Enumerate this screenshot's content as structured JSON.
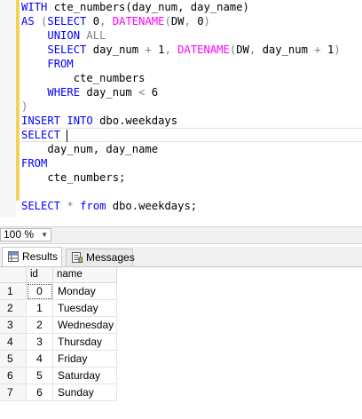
{
  "editor": {
    "lines": [
      [
        {
          "t": "WITH ",
          "c": "kw"
        },
        {
          "t": "cte_numbers(day_num, day_name)",
          "c": ""
        }
      ],
      [
        {
          "t": "AS ",
          "c": "kw"
        },
        {
          "t": "(",
          "c": "gr"
        },
        {
          "t": "SELECT ",
          "c": "kw"
        },
        {
          "t": "0",
          "c": ""
        },
        {
          "t": ", ",
          "c": "gr"
        },
        {
          "t": "DATENAME",
          "c": "fn"
        },
        {
          "t": "(",
          "c": "gr"
        },
        {
          "t": "DW",
          "c": ""
        },
        {
          "t": ", ",
          "c": "gr"
        },
        {
          "t": "0",
          "c": ""
        },
        {
          "t": ")",
          "c": "gr"
        }
      ],
      [
        {
          "t": "    ",
          "c": ""
        },
        {
          "t": "UNION ",
          "c": "kw"
        },
        {
          "t": "ALL",
          "c": "gr"
        }
      ],
      [
        {
          "t": "    ",
          "c": ""
        },
        {
          "t": "SELECT ",
          "c": "kw"
        },
        {
          "t": "day_num ",
          "c": ""
        },
        {
          "t": "+ ",
          "c": "gr"
        },
        {
          "t": "1",
          "c": ""
        },
        {
          "t": ", ",
          "c": "gr"
        },
        {
          "t": "DATENAME",
          "c": "fn"
        },
        {
          "t": "(",
          "c": "gr"
        },
        {
          "t": "DW",
          "c": ""
        },
        {
          "t": ", ",
          "c": "gr"
        },
        {
          "t": "day_num ",
          "c": ""
        },
        {
          "t": "+ ",
          "c": "gr"
        },
        {
          "t": "1",
          "c": ""
        },
        {
          "t": ")",
          "c": "gr"
        }
      ],
      [
        {
          "t": "    ",
          "c": ""
        },
        {
          "t": "FROM",
          "c": "kw"
        }
      ],
      [
        {
          "t": "        cte_numbers",
          "c": ""
        }
      ],
      [
        {
          "t": "    ",
          "c": ""
        },
        {
          "t": "WHERE ",
          "c": "kw"
        },
        {
          "t": "day_num ",
          "c": ""
        },
        {
          "t": "< ",
          "c": "gr"
        },
        {
          "t": "6",
          "c": ""
        }
      ],
      [
        {
          "t": ")",
          "c": "gr"
        }
      ],
      [
        {
          "t": "INSERT INTO ",
          "c": "kw"
        },
        {
          "t": "dbo.weekdays",
          "c": ""
        }
      ],
      [
        {
          "t": "SELECT ",
          "c": "kw"
        }
      ],
      [
        {
          "t": "    day_num, day_name",
          "c": ""
        }
      ],
      [
        {
          "t": "FROM",
          "c": "kw"
        }
      ],
      [
        {
          "t": "    cte_numbers;",
          "c": ""
        }
      ],
      [
        {
          "t": "",
          "c": ""
        }
      ],
      [
        {
          "t": "SELECT ",
          "c": "kw"
        },
        {
          "t": "* ",
          "c": "gr"
        },
        {
          "t": "from ",
          "c": "kw"
        },
        {
          "t": "dbo.weekdays;",
          "c": ""
        }
      ]
    ],
    "current_line": 9
  },
  "zoom": {
    "value": "100 %"
  },
  "tabs": [
    {
      "label": "Results",
      "icon": "grid-icon",
      "active": true
    },
    {
      "label": "Messages",
      "icon": "messages-icon",
      "active": false
    }
  ],
  "grid": {
    "columns": [
      "",
      "id",
      "name"
    ],
    "rows": [
      {
        "n": "1",
        "id": "0",
        "name": "Monday"
      },
      {
        "n": "2",
        "id": "1",
        "name": "Tuesday"
      },
      {
        "n": "3",
        "id": "2",
        "name": "Wednesday"
      },
      {
        "n": "4",
        "id": "3",
        "name": "Thursday"
      },
      {
        "n": "5",
        "id": "4",
        "name": "Friday"
      },
      {
        "n": "6",
        "id": "5",
        "name": "Saturday"
      },
      {
        "n": "7",
        "id": "6",
        "name": "Sunday"
      }
    ]
  }
}
